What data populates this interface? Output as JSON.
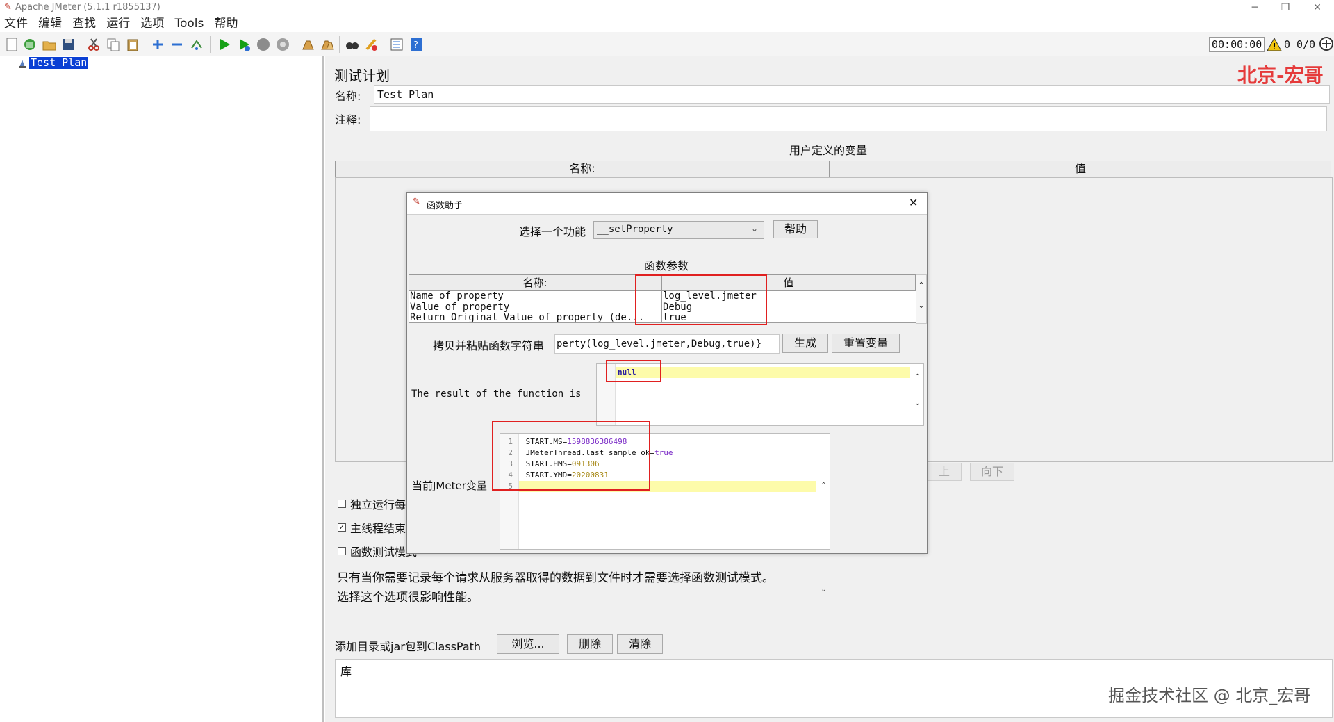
{
  "window": {
    "title": "Apache JMeter (5.1.1 r1855137)"
  },
  "menu": [
    "文件",
    "编辑",
    "查找",
    "运行",
    "选项",
    "Tools",
    "帮助"
  ],
  "toolbar": {
    "timer": "00:00:00",
    "warnings": "0",
    "threads": "0/0"
  },
  "tree": {
    "root_label": "Test Plan"
  },
  "plan": {
    "title": "测试计划",
    "name_label": "名称:",
    "name_value": "Test Plan",
    "comment_label": "注释:",
    "comment_value": "",
    "variables_title": "用户定义的变量",
    "col_name": "名称:",
    "col_value": "值",
    "btn_up": "上",
    "btn_down": "向下",
    "cb_serialize": "独立运行每",
    "cb_teardown": "主线程结束",
    "cb_functional": "函数测试模式",
    "note_line1": "只有当你需要记录每个请求从服务器取得的数据到文件时才需要选择函数测试模式。",
    "note_line2": "选择这个选项很影响性能。",
    "classpath_label": "添加目录或jar包到ClassPath",
    "btn_browse": "浏览...",
    "btn_delete": "删除",
    "btn_clear": "清除",
    "library_label": "库"
  },
  "watermark": {
    "brand": "北京-宏哥",
    "footer": "掘金技术社区 @ 北京_宏哥"
  },
  "dialog": {
    "title": "函数助手",
    "choose_label": "选择一个功能",
    "function_selected": "__setProperty",
    "btn_help": "帮助",
    "params_title": "函数参数",
    "col_name": "名称:",
    "col_value": "值",
    "params": [
      {
        "name": "Name of property",
        "value": "log_level.jmeter"
      },
      {
        "name": "Value of property",
        "value": "Debug"
      },
      {
        "name": "Return Original Value of property (de...",
        "value": "true"
      }
    ],
    "copy_label": "拷贝并粘贴函数字符串",
    "function_string": "perty(log_level.jmeter,Debug,true)}",
    "btn_generate": "生成",
    "btn_reset": "重置变量",
    "result_label": "The result of the function is",
    "result_value": "null",
    "vars_label": "当前JMeter变量",
    "vars": [
      {
        "no": "1",
        "key": "START.MS=",
        "val": "1598836386498"
      },
      {
        "no": "2",
        "key": "JMeterThread.last_sample_ok=",
        "val": "true"
      },
      {
        "no": "3",
        "key": "START.HMS=",
        "val": "091306"
      },
      {
        "no": "4",
        "key": "START.YMD=",
        "val": "20200831"
      },
      {
        "no": "5",
        "key": "",
        "val": ""
      }
    ]
  }
}
